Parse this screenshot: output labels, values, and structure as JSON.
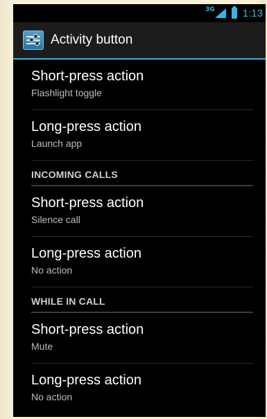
{
  "status_bar": {
    "network": "3G",
    "time": "1:13"
  },
  "action_bar": {
    "title": "Activity button"
  },
  "preferences": [
    {
      "type": "item",
      "title": "Short-press action",
      "summary": "Flashlight toggle"
    },
    {
      "type": "item",
      "title": "Long-press action",
      "summary": "Launch app"
    },
    {
      "type": "category",
      "title": "INCOMING CALLS"
    },
    {
      "type": "item",
      "title": "Short-press action",
      "summary": "Silence call"
    },
    {
      "type": "item",
      "title": "Long-press action",
      "summary": "No action"
    },
    {
      "type": "category",
      "title": "WHILE IN CALL"
    },
    {
      "type": "item",
      "title": "Short-press action",
      "summary": "Mute"
    },
    {
      "type": "item",
      "title": "Long-press action",
      "summary": "No action"
    }
  ],
  "colors": {
    "accent": "#33b5e5",
    "background": "#000000",
    "action_bar": "#1c1c1c"
  }
}
